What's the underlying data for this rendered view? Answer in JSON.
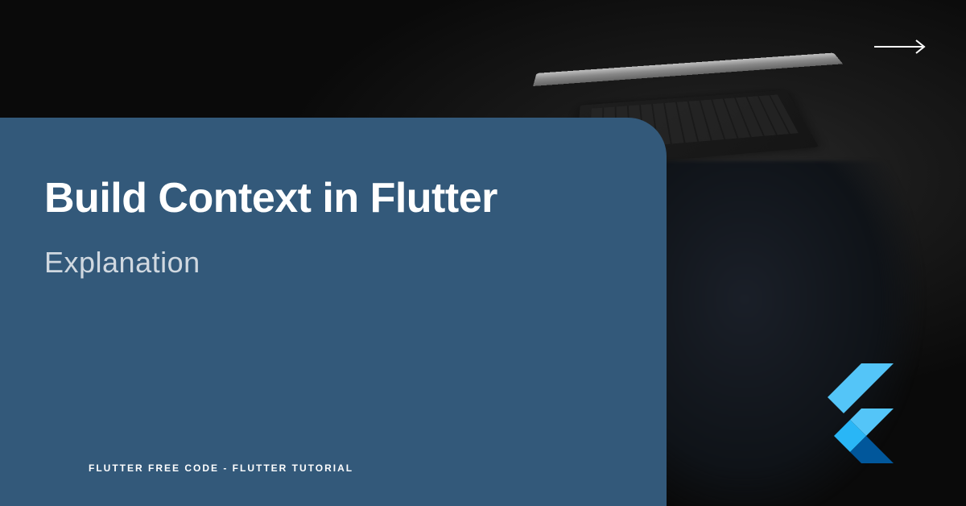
{
  "title": "Build Context in Flutter",
  "subtitle": "Explanation",
  "footer": "FLUTTER FREE CODE - FLUTTER TUTORIAL",
  "colors": {
    "card_background": "#33597a",
    "page_background": "#0a0a0a",
    "flutter_light_blue": "#54C5F8",
    "flutter_dark_blue": "#01579B",
    "flutter_mid_blue": "#29B6F6"
  }
}
